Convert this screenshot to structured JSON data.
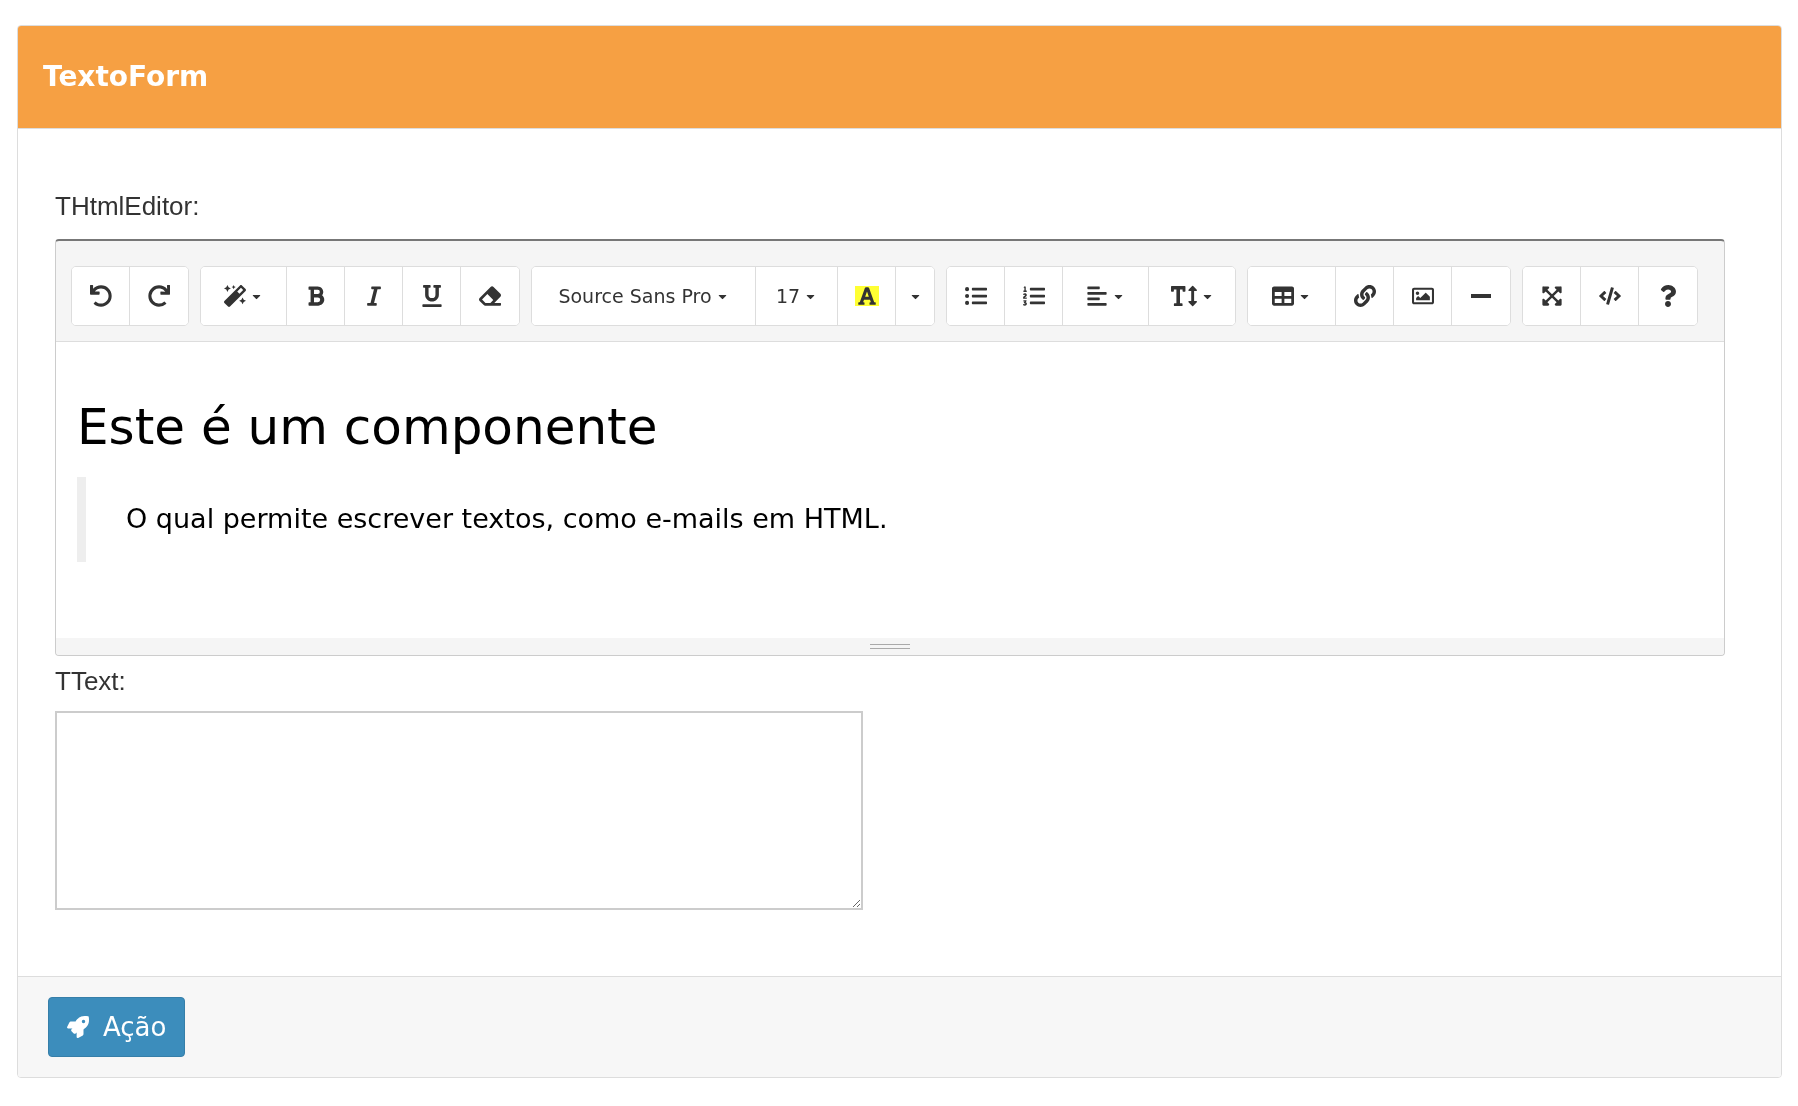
{
  "panel": {
    "title": "TextoForm"
  },
  "html_editor": {
    "label": "THtmlEditor:",
    "font_name": "Source Sans Pro",
    "font_size": "17",
    "heading": "Este é um componente",
    "quote": "O qual permite escrever textos, como e-mails em HTML."
  },
  "text_field": {
    "label": "TText:"
  },
  "footer": {
    "action_button": "Ação"
  }
}
